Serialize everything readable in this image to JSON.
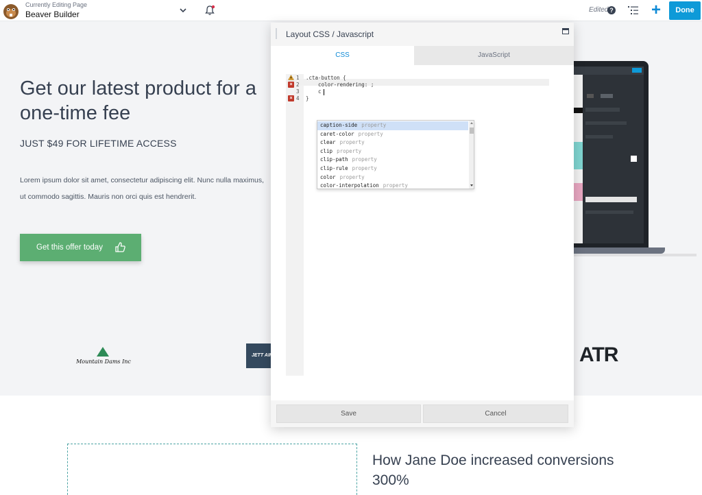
{
  "topbar": {
    "editing_label": "Currently Editing Page",
    "site_title": "Beaver Builder",
    "edited_status": "Edited",
    "help_glyph": "?",
    "add_glyph": "+",
    "done_label": "Done"
  },
  "hero": {
    "title": "Get our latest product for a one-time fee",
    "subtitle": "JUST $49 FOR LIFETIME ACCESS",
    "body": "Lorem ipsum dolor sit amet, consectetur adipiscing elit. Nunc nulla maximus, ut commodo sagittis. Mauris non orci quis est hendrerit.",
    "cta_label": "Get this offer today"
  },
  "logos": {
    "mountain": "Mountain Dams Inc",
    "jett": "JETT AIR",
    "atr": "ATR"
  },
  "case_study": {
    "heading": "How Jane Doe increased conversions 300%"
  },
  "modal": {
    "title": "Layout CSS / Javascript",
    "tabs": {
      "css": "CSS",
      "javascript": "JavaScript"
    },
    "code_lines": [
      ".cta-button {",
      "    color-rendering: ;",
      "    c",
      "}"
    ],
    "line_numbers": [
      "1",
      "2",
      "3",
      "4"
    ],
    "error_glyph": "×",
    "autocomplete": [
      {
        "name": "caption-side",
        "kind": "property"
      },
      {
        "name": "caret-color",
        "kind": "property"
      },
      {
        "name": "clear",
        "kind": "property"
      },
      {
        "name": "clip",
        "kind": "property"
      },
      {
        "name": "clip-path",
        "kind": "property"
      },
      {
        "name": "clip-rule",
        "kind": "property"
      },
      {
        "name": "color",
        "kind": "property"
      },
      {
        "name": "color-interpolation",
        "kind": "property"
      }
    ],
    "save_label": "Save",
    "cancel_label": "Cancel"
  },
  "colors": {
    "accent": "#0e9ad8",
    "cta": "#5cae72",
    "error": "#c0392b",
    "warning": "#e0a32e"
  }
}
